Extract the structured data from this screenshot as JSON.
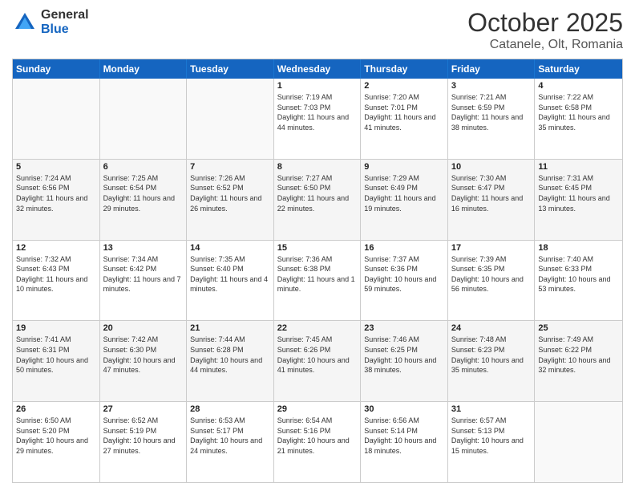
{
  "logo": {
    "general": "General",
    "blue": "Blue"
  },
  "header": {
    "month_year": "October 2025",
    "location": "Catanele, Olt, Romania"
  },
  "days_of_week": [
    "Sunday",
    "Monday",
    "Tuesday",
    "Wednesday",
    "Thursday",
    "Friday",
    "Saturday"
  ],
  "weeks": [
    [
      {
        "day": "",
        "info": ""
      },
      {
        "day": "",
        "info": ""
      },
      {
        "day": "",
        "info": ""
      },
      {
        "day": "1",
        "info": "Sunrise: 7:19 AM\nSunset: 7:03 PM\nDaylight: 11 hours and 44 minutes."
      },
      {
        "day": "2",
        "info": "Sunrise: 7:20 AM\nSunset: 7:01 PM\nDaylight: 11 hours and 41 minutes."
      },
      {
        "day": "3",
        "info": "Sunrise: 7:21 AM\nSunset: 6:59 PM\nDaylight: 11 hours and 38 minutes."
      },
      {
        "day": "4",
        "info": "Sunrise: 7:22 AM\nSunset: 6:58 PM\nDaylight: 11 hours and 35 minutes."
      }
    ],
    [
      {
        "day": "5",
        "info": "Sunrise: 7:24 AM\nSunset: 6:56 PM\nDaylight: 11 hours and 32 minutes."
      },
      {
        "day": "6",
        "info": "Sunrise: 7:25 AM\nSunset: 6:54 PM\nDaylight: 11 hours and 29 minutes."
      },
      {
        "day": "7",
        "info": "Sunrise: 7:26 AM\nSunset: 6:52 PM\nDaylight: 11 hours and 26 minutes."
      },
      {
        "day": "8",
        "info": "Sunrise: 7:27 AM\nSunset: 6:50 PM\nDaylight: 11 hours and 22 minutes."
      },
      {
        "day": "9",
        "info": "Sunrise: 7:29 AM\nSunset: 6:49 PM\nDaylight: 11 hours and 19 minutes."
      },
      {
        "day": "10",
        "info": "Sunrise: 7:30 AM\nSunset: 6:47 PM\nDaylight: 11 hours and 16 minutes."
      },
      {
        "day": "11",
        "info": "Sunrise: 7:31 AM\nSunset: 6:45 PM\nDaylight: 11 hours and 13 minutes."
      }
    ],
    [
      {
        "day": "12",
        "info": "Sunrise: 7:32 AM\nSunset: 6:43 PM\nDaylight: 11 hours and 10 minutes."
      },
      {
        "day": "13",
        "info": "Sunrise: 7:34 AM\nSunset: 6:42 PM\nDaylight: 11 hours and 7 minutes."
      },
      {
        "day": "14",
        "info": "Sunrise: 7:35 AM\nSunset: 6:40 PM\nDaylight: 11 hours and 4 minutes."
      },
      {
        "day": "15",
        "info": "Sunrise: 7:36 AM\nSunset: 6:38 PM\nDaylight: 11 hours and 1 minute."
      },
      {
        "day": "16",
        "info": "Sunrise: 7:37 AM\nSunset: 6:36 PM\nDaylight: 10 hours and 59 minutes."
      },
      {
        "day": "17",
        "info": "Sunrise: 7:39 AM\nSunset: 6:35 PM\nDaylight: 10 hours and 56 minutes."
      },
      {
        "day": "18",
        "info": "Sunrise: 7:40 AM\nSunset: 6:33 PM\nDaylight: 10 hours and 53 minutes."
      }
    ],
    [
      {
        "day": "19",
        "info": "Sunrise: 7:41 AM\nSunset: 6:31 PM\nDaylight: 10 hours and 50 minutes."
      },
      {
        "day": "20",
        "info": "Sunrise: 7:42 AM\nSunset: 6:30 PM\nDaylight: 10 hours and 47 minutes."
      },
      {
        "day": "21",
        "info": "Sunrise: 7:44 AM\nSunset: 6:28 PM\nDaylight: 10 hours and 44 minutes."
      },
      {
        "day": "22",
        "info": "Sunrise: 7:45 AM\nSunset: 6:26 PM\nDaylight: 10 hours and 41 minutes."
      },
      {
        "day": "23",
        "info": "Sunrise: 7:46 AM\nSunset: 6:25 PM\nDaylight: 10 hours and 38 minutes."
      },
      {
        "day": "24",
        "info": "Sunrise: 7:48 AM\nSunset: 6:23 PM\nDaylight: 10 hours and 35 minutes."
      },
      {
        "day": "25",
        "info": "Sunrise: 7:49 AM\nSunset: 6:22 PM\nDaylight: 10 hours and 32 minutes."
      }
    ],
    [
      {
        "day": "26",
        "info": "Sunrise: 6:50 AM\nSunset: 5:20 PM\nDaylight: 10 hours and 29 minutes."
      },
      {
        "day": "27",
        "info": "Sunrise: 6:52 AM\nSunset: 5:19 PM\nDaylight: 10 hours and 27 minutes."
      },
      {
        "day": "28",
        "info": "Sunrise: 6:53 AM\nSunset: 5:17 PM\nDaylight: 10 hours and 24 minutes."
      },
      {
        "day": "29",
        "info": "Sunrise: 6:54 AM\nSunset: 5:16 PM\nDaylight: 10 hours and 21 minutes."
      },
      {
        "day": "30",
        "info": "Sunrise: 6:56 AM\nSunset: 5:14 PM\nDaylight: 10 hours and 18 minutes."
      },
      {
        "day": "31",
        "info": "Sunrise: 6:57 AM\nSunset: 5:13 PM\nDaylight: 10 hours and 15 minutes."
      },
      {
        "day": "",
        "info": ""
      }
    ]
  ]
}
